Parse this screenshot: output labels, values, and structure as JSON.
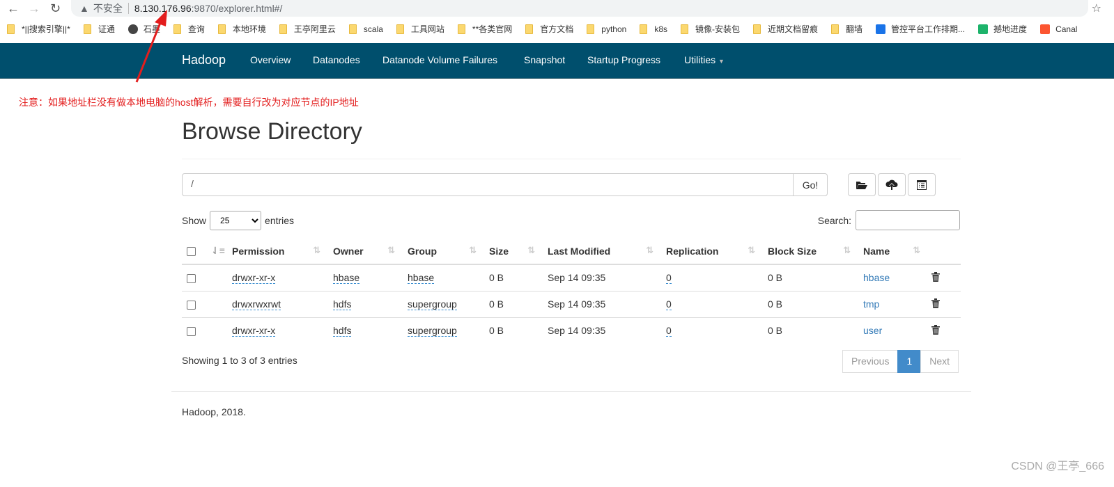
{
  "browser": {
    "security_label": "不安全",
    "url_host": "8.130.176.96",
    "url_path": ":9870/explorer.html#/",
    "bookmarks": [
      {
        "label": "*||搜索引擎||*",
        "icon": "folder-icon"
      },
      {
        "label": "证通",
        "icon": "folder-icon"
      },
      {
        "label": "石墨",
        "icon": "shimo-icon"
      },
      {
        "label": "查询",
        "icon": "folder-icon"
      },
      {
        "label": "本地环境",
        "icon": "folder-icon"
      },
      {
        "label": "王亭阿里云",
        "icon": "folder-icon"
      },
      {
        "label": "scala",
        "icon": "folder-icon"
      },
      {
        "label": "工具网站",
        "icon": "folder-icon"
      },
      {
        "label": "**各类官网",
        "icon": "folder-icon"
      },
      {
        "label": "官方文档",
        "icon": "folder-icon"
      },
      {
        "label": "python",
        "icon": "folder-icon"
      },
      {
        "label": "k8s",
        "icon": "folder-icon"
      },
      {
        "label": "镜像-安装包",
        "icon": "folder-icon"
      },
      {
        "label": "近期文档留痕",
        "icon": "folder-icon"
      },
      {
        "label": "翻墙",
        "icon": "folder-icon"
      },
      {
        "label": "管控平台工作排期...",
        "icon": "app-icon"
      },
      {
        "label": "撼地进度",
        "icon": "sheet-icon"
      },
      {
        "label": "Canal",
        "icon": "csdn-icon"
      }
    ]
  },
  "navbar": {
    "brand": "Hadoop",
    "items": [
      "Overview",
      "Datanodes",
      "Datanode Volume Failures",
      "Snapshot",
      "Startup Progress",
      "Utilities"
    ],
    "color": "#004f6d"
  },
  "annotation": "注意：如果地址栏没有做本地电脑的host解析，需要自行改为对应节点的IP地址",
  "page": {
    "title": "Browse Directory",
    "path_value": "/",
    "go_label": "Go!",
    "show_label": "Show",
    "entries_label": "entries",
    "page_size": "25",
    "search_label": "Search:",
    "columns": [
      "Permission",
      "Owner",
      "Group",
      "Size",
      "Last Modified",
      "Replication",
      "Block Size",
      "Name"
    ],
    "rows": [
      {
        "permission": "drwxr-xr-x",
        "owner": "hbase",
        "group": "hbase",
        "size": "0 B",
        "modified": "Sep 14 09:35",
        "replication": "0",
        "block_size": "0 B",
        "name": "hbase"
      },
      {
        "permission": "drwxrwxrwt",
        "owner": "hdfs",
        "group": "supergroup",
        "size": "0 B",
        "modified": "Sep 14 09:35",
        "replication": "0",
        "block_size": "0 B",
        "name": "tmp"
      },
      {
        "permission": "drwxr-xr-x",
        "owner": "hdfs",
        "group": "supergroup",
        "size": "0 B",
        "modified": "Sep 14 09:35",
        "replication": "0",
        "block_size": "0 B",
        "name": "user"
      }
    ],
    "info": "Showing 1 to 3 of 3 entries",
    "pagination": {
      "previous": "Previous",
      "current": "1",
      "next": "Next"
    },
    "footer": "Hadoop, 2018."
  },
  "watermark": "CSDN @王亭_666"
}
